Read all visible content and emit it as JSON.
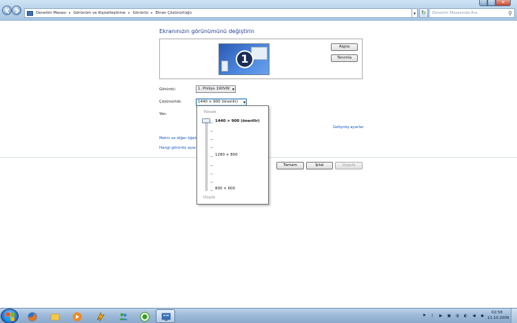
{
  "address_bar": {
    "crumbs": [
      "Denetim Masası",
      "Görünüm ve Kişiselleştirme",
      "Görüntü",
      "Ekran Çözünürlüğü"
    ],
    "search_placeholder": "Denetim Masasında Ara"
  },
  "page": {
    "title": "Ekranınızın görünümünü değiştirin",
    "monitor_number": "1",
    "detect_label": "Algıla",
    "identify_label": "Tanımla",
    "display_label": "Görüntü:",
    "display_value": "1. Philips 190VW",
    "resolution_label": "Çözünürlük:",
    "resolution_value": "1440 × 900 (önerilir)",
    "orientation_label": "Yön:",
    "advanced_link": "Gelişmiş ayarlar",
    "text_link": "Metni ve diğer öğeleri daha büyük veya daha küçük yap",
    "which_link": "Hangi görüntü ayarlarını seçmeliyim?",
    "ok_label": "Tamam",
    "cancel_label": "İptal",
    "apply_label": "Uygula"
  },
  "resolution_popup": {
    "high_label": "Yüksek",
    "low_label": "Düşük",
    "options": [
      "1440 × 900 (önerilir)",
      "1280 × 800",
      "800 × 600"
    ],
    "selected_index": 0
  },
  "taskbar": {
    "apps": [
      "firefox",
      "windows-explorer",
      "media-player",
      "winamp",
      "messenger",
      "xbox",
      "control-panel"
    ],
    "active_app": "control-panel",
    "clock_time": "02:58",
    "clock_date": "11.10.2009"
  }
}
